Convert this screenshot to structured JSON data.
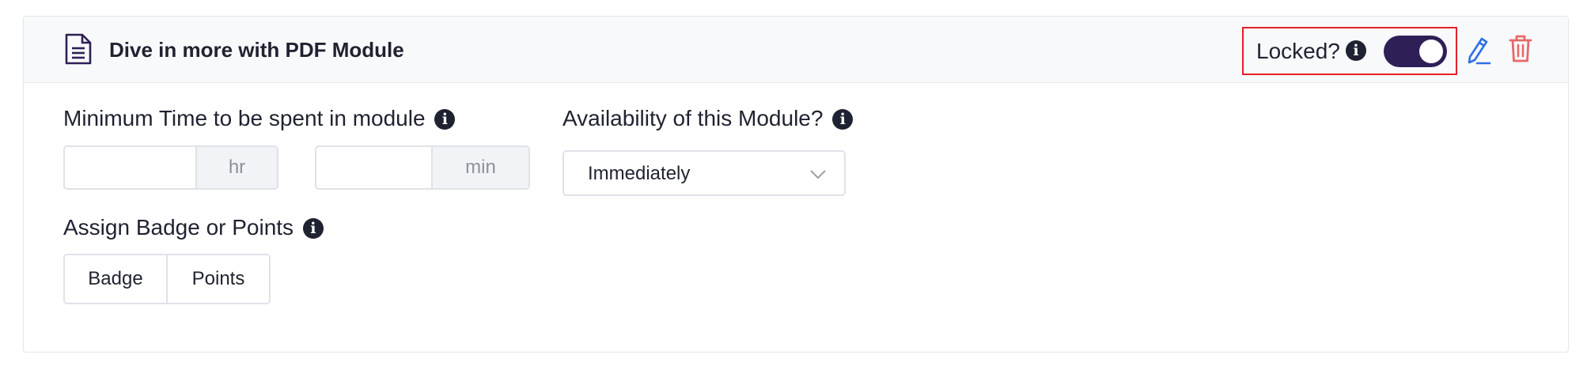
{
  "module": {
    "title": "Dive in more with PDF Module",
    "icon": "document-icon"
  },
  "header_actions": {
    "locked_label": "Locked?",
    "locked_on": true,
    "toggle_color": "#2f1f57",
    "edit_icon": "edit-pencil-icon",
    "delete_icon": "trash-icon",
    "edit_color": "#2f6fe4",
    "delete_color": "#e8686a",
    "highlight_color": "#e3202a"
  },
  "min_time": {
    "label": "Minimum Time to be spent in module",
    "hours_value": "",
    "hours_unit": "hr",
    "minutes_value": "",
    "minutes_unit": "min"
  },
  "availability": {
    "label": "Availability of this Module?",
    "selected": "Immediately"
  },
  "badge_points": {
    "label": "Assign Badge or Points",
    "badge_label": "Badge",
    "points_label": "Points"
  },
  "info_glyph": "i"
}
